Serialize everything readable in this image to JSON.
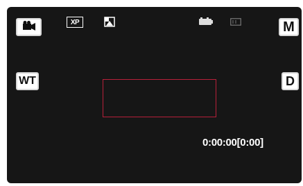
{
  "buttons": {
    "mode_icon": "video-camera-icon",
    "manual_label": "M",
    "zoom_label": "WT",
    "display_label": "D"
  },
  "indicators": {
    "quality_label": "XP",
    "scene_icon": "scene-mode-icon",
    "battery_icon": "battery-icon",
    "card_icon": "sd-card-icon"
  },
  "status": {
    "timecode": "0:00:00[0:00]"
  },
  "colors": {
    "screen_background": "#161616",
    "focus_frame": "#b8203a",
    "button_face": "#ffffff",
    "text": "#ffffff"
  }
}
